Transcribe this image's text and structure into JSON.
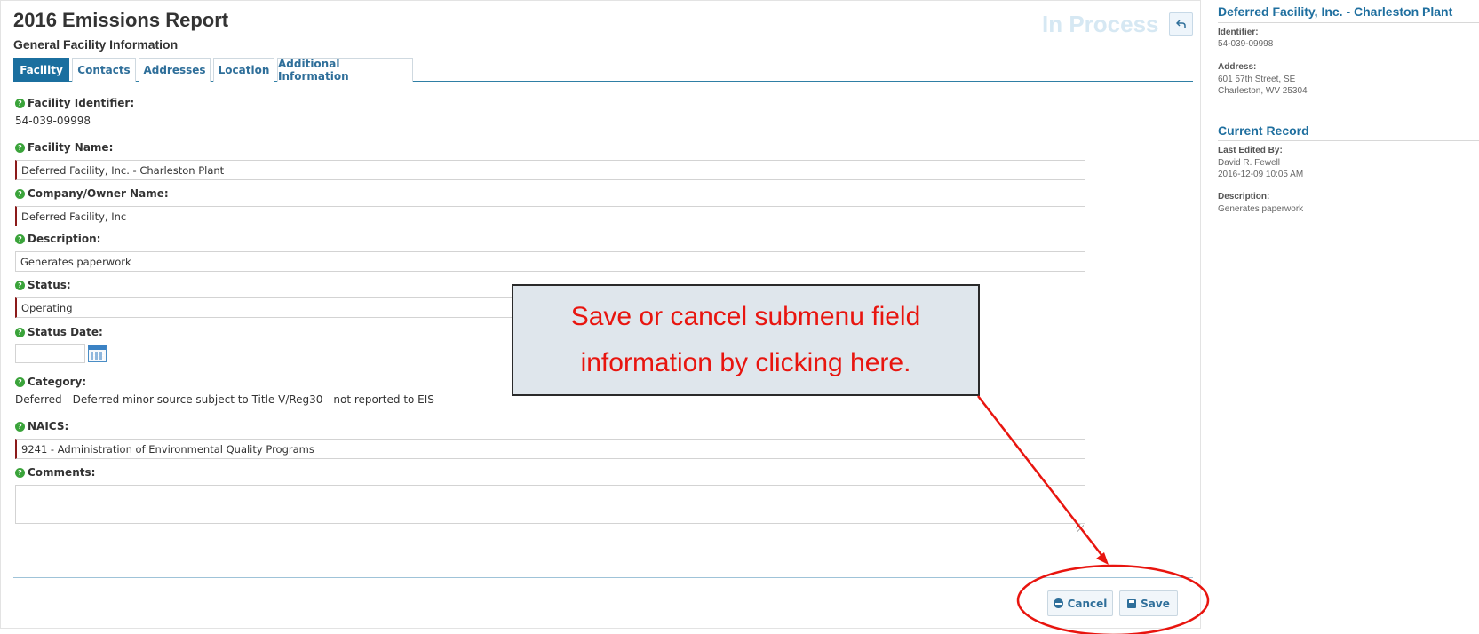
{
  "header": {
    "title": "2016 Emissions Report",
    "subtitle": "General Facility Information",
    "status": "In Process",
    "back_icon": "undo-arrow-icon"
  },
  "tabs": [
    {
      "label": "Facility",
      "active": true
    },
    {
      "label": "Contacts",
      "active": false
    },
    {
      "label": "Addresses",
      "active": false
    },
    {
      "label": "Location",
      "active": false
    },
    {
      "label": "Additional Information",
      "active": false
    }
  ],
  "form": {
    "help_icon": "question-circle-icon",
    "facility_identifier": {
      "label": "Facility Identifier:",
      "value": "54-039-09998"
    },
    "facility_name": {
      "label": "Facility Name:",
      "value": "Deferred Facility, Inc. - Charleston Plant"
    },
    "company_owner": {
      "label": "Company/Owner Name:",
      "value": "Deferred Facility, Inc"
    },
    "description": {
      "label": "Description:",
      "value": "Generates paperwork"
    },
    "status": {
      "label": "Status:",
      "value": "Operating"
    },
    "status_date": {
      "label": "Status Date:",
      "value": "",
      "icon": "calendar-icon"
    },
    "category": {
      "label": "Category:",
      "value": "Deferred - Deferred minor source subject to Title V/Reg30 - not reported to EIS"
    },
    "naics": {
      "label": "NAICS:",
      "value": "9241 - Administration of Environmental Quality Programs"
    },
    "comments": {
      "label": "Comments:",
      "value": ""
    }
  },
  "actions": {
    "cancel_label": "Cancel",
    "save_label": "Save"
  },
  "sidebar": {
    "facility_title": "Deferred Facility, Inc. - Charleston Plant",
    "identifier_label": "Identifier:",
    "identifier_value": "54-039-09998",
    "address_label": "Address:",
    "address_line1": "601 57th Street, SE",
    "address_line2": "Charleston, WV 25304",
    "record_title": "Current Record",
    "last_edited_label": "Last Edited By:",
    "last_edited_name": "David R. Fewell",
    "last_edited_time": "2016-12-09 10:05 AM",
    "description_label": "Description:",
    "description_value": "Generates paperwork"
  },
  "annotation": {
    "callout_line1": "Save or cancel submenu field",
    "callout_line2": "information by clicking here.",
    "color": "#e8150f"
  },
  "colors": {
    "accent": "#1b6f9f",
    "required_marker": "#8b1a1a",
    "help_icon": "#3aa33a",
    "status_text": "#d6e8f3"
  }
}
